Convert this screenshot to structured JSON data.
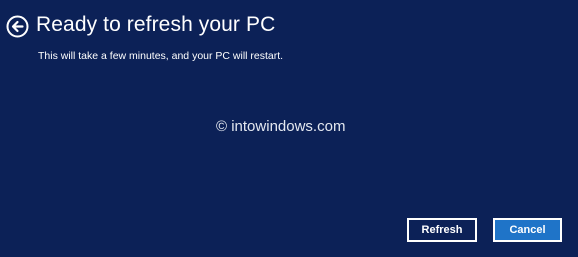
{
  "header": {
    "back_icon": "back-arrow-circle-icon",
    "title": "Ready to refresh your PC"
  },
  "main": {
    "subtitle": "This will take a few minutes, and your PC will restart.",
    "watermark": "© intowindows.com"
  },
  "actions": {
    "refresh_label": "Refresh",
    "cancel_label": "Cancel"
  },
  "colors": {
    "background": "#0c2157",
    "primary_button": "#1f74c8",
    "text": "#ffffff"
  }
}
